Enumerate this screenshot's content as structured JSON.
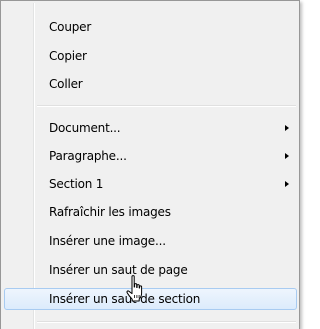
{
  "menu": {
    "items": [
      {
        "label": "Couper",
        "submenu": false
      },
      {
        "label": "Copier",
        "submenu": false
      },
      {
        "label": "Coller",
        "submenu": false
      },
      {
        "label": "Document...",
        "submenu": true
      },
      {
        "label": "Paragraphe...",
        "submenu": true
      },
      {
        "label": "Section 1",
        "submenu": true
      },
      {
        "label": "Rafraîchir les images",
        "submenu": false
      },
      {
        "label": "Insérer une image...",
        "submenu": false
      },
      {
        "label": "Insérer un saut de page",
        "submenu": false
      },
      {
        "label": "Insérer un saut de section",
        "submenu": false,
        "state": "hover"
      }
    ]
  },
  "icons": {
    "submenu_arrow": "chevron-right-icon",
    "cursor": "hand-pointer-cursor"
  },
  "colors": {
    "menu_background": "#f0f0f0",
    "hover_border": "#a8cbf1",
    "hover_fill": "#dcebfc"
  }
}
